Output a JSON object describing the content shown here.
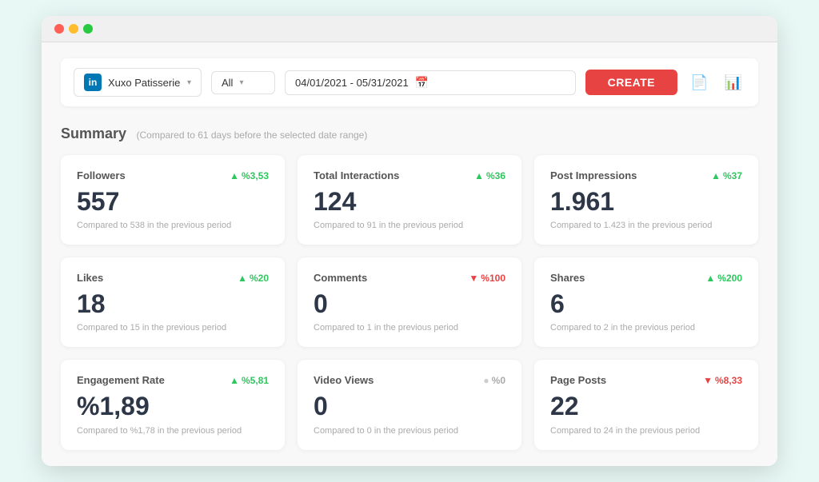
{
  "browser": {
    "dots": [
      "red",
      "yellow",
      "green"
    ]
  },
  "toolbar": {
    "account": {
      "name": "Xuxo Patisserie",
      "platform": "in"
    },
    "filter": {
      "label": "All"
    },
    "date_range": "04/01/2021 - 05/31/2021",
    "create_label": "CREATE"
  },
  "summary": {
    "title": "Summary",
    "subtitle": "(Compared to 61 days before the selected date range)"
  },
  "cards": [
    {
      "title": "Followers",
      "badge": "%3,53",
      "badge_type": "green",
      "value": "557",
      "compare": "Compared to 538 in the previous period"
    },
    {
      "title": "Total Interactions",
      "badge": "%36",
      "badge_type": "green",
      "value": "124",
      "compare": "Compared to 91 in the previous period"
    },
    {
      "title": "Post Impressions",
      "badge": "%37",
      "badge_type": "green",
      "value": "1.961",
      "compare": "Compared to 1.423 in the previous period"
    },
    {
      "title": "Likes",
      "badge": "%20",
      "badge_type": "green",
      "value": "18",
      "compare": "Compared to 15 in the previous period"
    },
    {
      "title": "Comments",
      "badge": "%100",
      "badge_type": "red",
      "value": "0",
      "compare": "Compared to 1 in the previous period"
    },
    {
      "title": "Shares",
      "badge": "%200",
      "badge_type": "green",
      "value": "6",
      "compare": "Compared to 2 in the previous period"
    },
    {
      "title": "Engagement Rate",
      "badge": "%5,81",
      "badge_type": "green",
      "value": "%1,89",
      "compare": "Compared to %1,78 in the previous period"
    },
    {
      "title": "Video Views",
      "badge": "%0",
      "badge_type": "gray",
      "value": "0",
      "compare": "Compared to 0 in the previous period"
    },
    {
      "title": "Page Posts",
      "badge": "%8,33",
      "badge_type": "red",
      "value": "22",
      "compare": "Compared to 24 in the previous period"
    }
  ]
}
